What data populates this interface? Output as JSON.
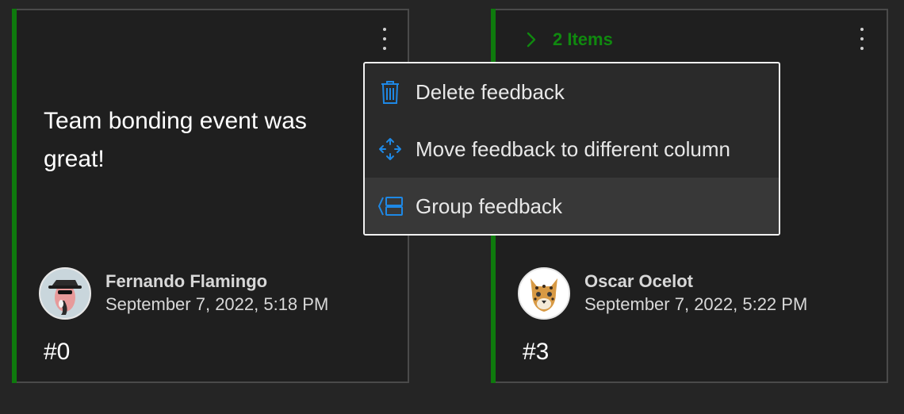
{
  "cards": {
    "left": {
      "text": "Team bonding event was great!",
      "author_name": "Fernando Flamingo",
      "author_date": "September 7, 2022, 5:18 PM",
      "number": "#0"
    },
    "right": {
      "group_label": "2 Items",
      "author_name": "Oscar Ocelot",
      "author_date": "September 7, 2022, 5:22 PM",
      "number": "#3"
    }
  },
  "menu": {
    "items": [
      {
        "label": "Delete feedback",
        "icon": "trash-icon"
      },
      {
        "label": "Move feedback to different column",
        "icon": "move-icon"
      },
      {
        "label": "Group feedback",
        "icon": "group-icon"
      }
    ]
  },
  "colors": {
    "accent": "#0e7a0d",
    "group_text": "#10890f",
    "icon_blue": "#1e88e5"
  }
}
